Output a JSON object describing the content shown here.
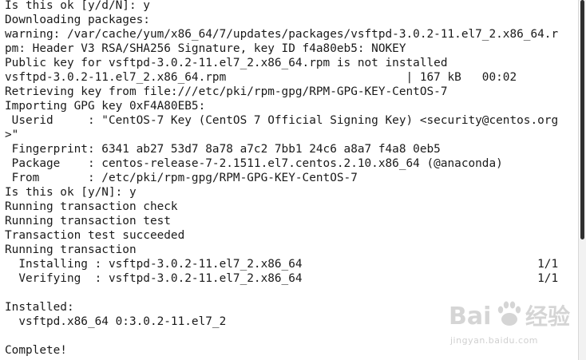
{
  "terminal": {
    "lines": [
      "Is this ok [y/d/N]: y",
      "Downloading packages:",
      "warning: /var/cache/yum/x86_64/7/updates/packages/vsftpd-3.0.2-11.el7_2.x86_64.r",
      "pm: Header V3 RSA/SHA256 Signature, key ID f4a80eb5: NOKEY",
      "Public key for vsftpd-3.0.2-11.el7_2.x86_64.rpm is not installed",
      "vsftpd-3.0.2-11.el7_2.x86_64.rpm                          | 167 kB   00:02",
      "Retrieving key from file:///etc/pki/rpm-gpg/RPM-GPG-KEY-CentOS-7",
      "Importing GPG key 0xF4A80EB5:",
      " Userid     : \"CentOS-7 Key (CentOS 7 Official Signing Key) <security@centos.org",
      ">\"",
      " Fingerprint: 6341 ab27 53d7 8a78 a7c2 7bb1 24c6 a8a7 f4a8 0eb5",
      " Package    : centos-release-7-2.1511.el7.centos.2.10.x86_64 (@anaconda)",
      " From       : /etc/pki/rpm-gpg/RPM-GPG-KEY-CentOS-7",
      "Is this ok [y/N]: y",
      "Running transaction check",
      "Running transaction test",
      "Transaction test succeeded",
      "Running transaction",
      "  Installing : vsftpd-3.0.2-11.el7_2.x86_64                                  1/1",
      "  Verifying  : vsftpd-3.0.2-11.el7_2.x86_64                                  1/1",
      "",
      "Installed:",
      "  vsftpd.x86_64 0:3.0.2-11.el7_2",
      "",
      "Complete!"
    ]
  },
  "watermark": {
    "brand_left": "Bai",
    "brand_right": "经验",
    "url": "jingyan.baidu.com"
  },
  "colors": {
    "background": "#ffffff",
    "text": "#1a1a1a",
    "scroll_thumb": "#2f2f2f"
  }
}
